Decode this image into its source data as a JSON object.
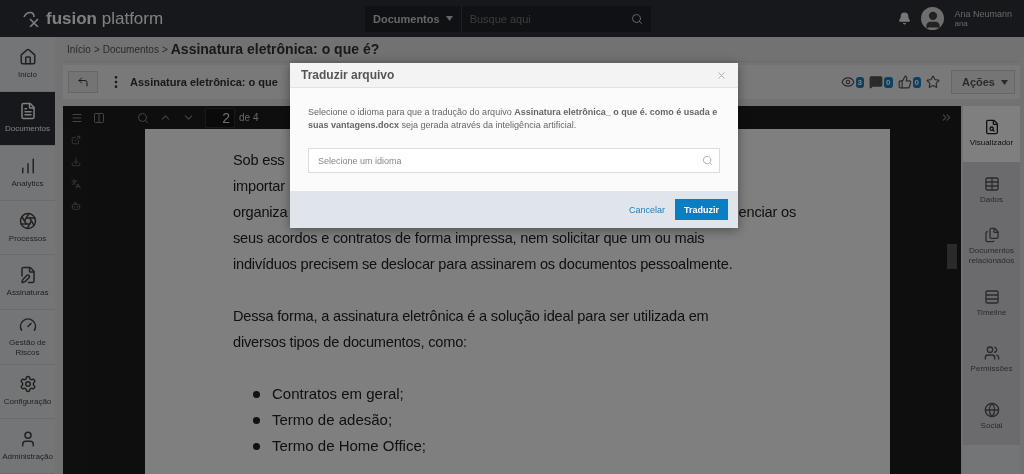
{
  "header": {
    "logo_bold": "fusion",
    "logo_light": "platform",
    "search_scope": "Documentos",
    "search_placeholder": "Busque aqui",
    "user": {
      "name": "Ana Neumann",
      "login": "ana"
    }
  },
  "sidebar": {
    "items": [
      {
        "kind": "home",
        "label": "Início",
        "selected": false
      },
      {
        "kind": "documents",
        "label": "Documentos",
        "selected": true
      },
      {
        "kind": "analytics",
        "label": "Analytics",
        "selected": false
      },
      {
        "kind": "processes",
        "label": "Processos",
        "selected": false
      },
      {
        "kind": "signatures",
        "label": "Assinaturas",
        "selected": false
      },
      {
        "kind": "risks",
        "label": "Gestão de Riscos",
        "selected": false
      },
      {
        "kind": "settings",
        "label": "Configuração",
        "selected": false
      },
      {
        "kind": "admin",
        "label": "Administração",
        "selected": false
      }
    ]
  },
  "breadcrumb": {
    "items": [
      "Início",
      "Documentos"
    ],
    "separator": ">",
    "current": "Assinatura eletrônica: o que é?"
  },
  "document_header": {
    "title": "Assinatura eletrônica: o que",
    "counters": [
      {
        "kind": "views",
        "value": "3"
      },
      {
        "kind": "comments",
        "value": "0"
      },
      {
        "kind": "likes",
        "value": "0"
      }
    ],
    "favorite": false,
    "actions_label": "Ações"
  },
  "viewer": {
    "page": "2",
    "page_total": "de 4",
    "blocks": [
      {
        "kind": "text",
        "lines": [
          [
            "Sob ess"
          ],
          [
            "importar"
          ],
          [
            "organiza",
            "enciar os"
          ],
          [
            "seus acordos e contratos de forma impressa, nem solicitar que um ou mais"
          ],
          [
            "indivíduos precisem se deslocar para assinarem os documentos pessoalmente."
          ]
        ]
      },
      {
        "kind": "text",
        "lines": [
          [
            "Dessa forma, a assinatura eletrônica é a solução ideal para ser utilizada em"
          ],
          [
            "diversos tipos de documentos, como:"
          ]
        ]
      },
      {
        "kind": "bullets",
        "items": [
          "Contratos em geral;",
          "Termo de adesão;",
          "Termo de Home Office;"
        ]
      }
    ]
  },
  "right_panel": {
    "items": [
      {
        "kind": "viewer",
        "label": "Visualizador",
        "selected": true
      },
      {
        "kind": "data",
        "label": "Dados",
        "selected": false
      },
      {
        "kind": "related",
        "label": "Documentos relacionados",
        "selected": false
      },
      {
        "kind": "timeline",
        "label": "Timeline",
        "selected": false
      },
      {
        "kind": "permissions",
        "label": "Permissões",
        "selected": false
      },
      {
        "kind": "social",
        "label": "Social",
        "selected": false
      }
    ]
  },
  "dialog": {
    "title": "Traduzir arquivo",
    "message": "Selecione o idioma para que a tradução do arquivo **Assinatura eletrônica_ o que é. como é usada e suas vantagens.docx** seja gerada através da inteligência artificial.",
    "placeholder": "Selecione um idioma",
    "cancel": "Cancelar",
    "confirm": "Traduzir"
  }
}
